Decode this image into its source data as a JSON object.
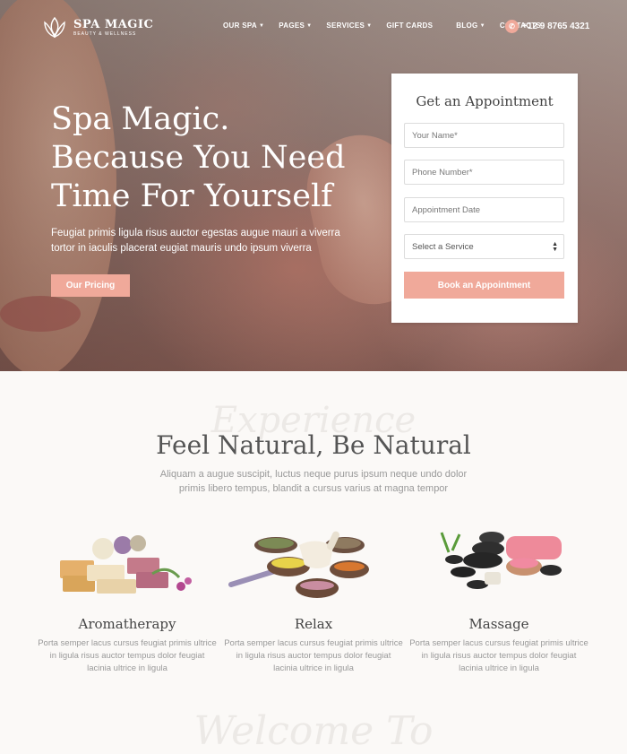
{
  "brand": {
    "name": "SPA MAGIC",
    "tagline": "BEAUTY & WELLNESS"
  },
  "nav": {
    "items": [
      {
        "label": "OUR SPA",
        "dropdown": true
      },
      {
        "label": "PAGES",
        "dropdown": true
      },
      {
        "label": "SERVICES",
        "dropdown": true
      },
      {
        "label": "GIFT CARDS",
        "dropdown": false
      },
      {
        "label": "BLOG",
        "dropdown": true
      },
      {
        "label": "CONTACTS",
        "dropdown": false
      }
    ],
    "phone": "+12 9 8765 4321"
  },
  "hero": {
    "headline": [
      "Spa Magic.",
      "Because You Need",
      "Time For Yourself"
    ],
    "description": "Feugiat primis ligula risus auctor egestas augue mauri a viverra tortor in iaculis placerat eugiat mauris undo ipsum viverra",
    "cta": "Our Pricing"
  },
  "appointment": {
    "title": "Get an Appointment",
    "name_placeholder": "Your Name*",
    "phone_placeholder": "Phone Number*",
    "date_placeholder": "Appointment Date",
    "service_selected": "Select a Service",
    "submit": "Book an Appointment"
  },
  "section": {
    "script_text": "Experience",
    "title": "Feel Natural, Be Natural",
    "description": "Aliquam a augue suscipit, luctus neque purus ipsum neque undo dolor primis libero tempus, blandit a cursus varius at magna tempor",
    "features": [
      {
        "title": "Aromatherapy",
        "text": "Porta semper lacus cursus feugiat primis ultrice in ligula risus auctor tempus dolor feugiat lacinia ultrice in ligula"
      },
      {
        "title": "Relax",
        "text": "Porta semper lacus cursus feugiat primis ultrice in ligula risus auctor tempus dolor feugiat lacinia ultrice in ligula"
      },
      {
        "title": "Massage",
        "text": "Porta semper lacus cursus feugiat primis ultrice in ligula risus auctor tempus dolor feugiat lacinia ultrice in ligula"
      }
    ],
    "script_text_2": "Welcome To"
  },
  "colors": {
    "accent": "#f0a99a",
    "title": "#555555",
    "muted": "#999999"
  }
}
